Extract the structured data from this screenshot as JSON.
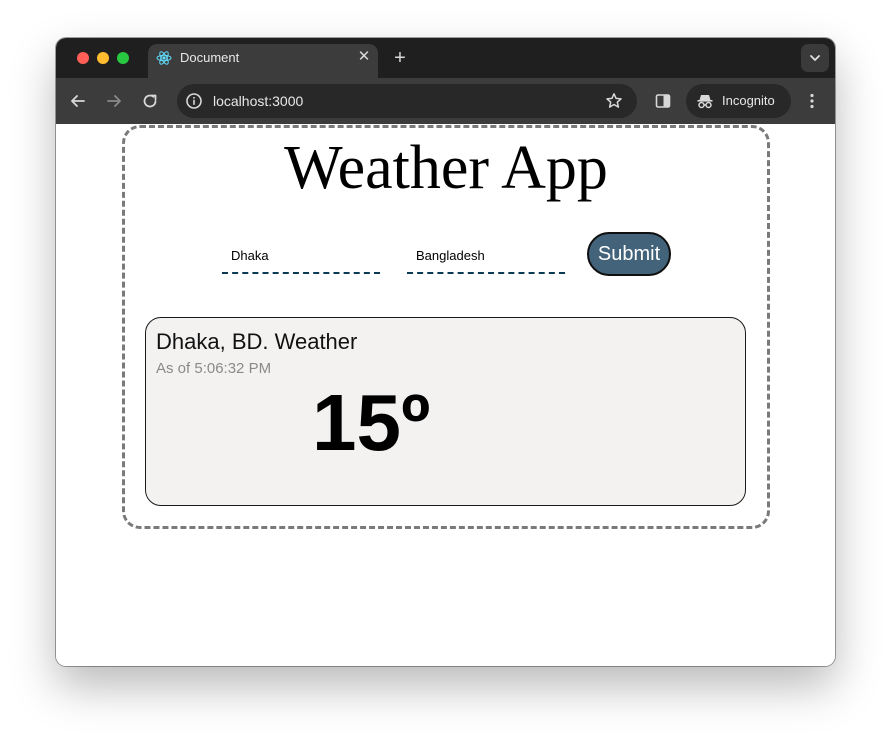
{
  "browser": {
    "tab_title": "Document",
    "url": "localhost:3000",
    "incognito_label": "Incognito",
    "icons": {
      "favicon": "react-icon",
      "tab_close": "close-icon",
      "new_tab": "plus-icon",
      "tab_menu": "chevron-down-icon",
      "back": "back-arrow-icon",
      "forward": "forward-arrow-icon",
      "reload": "reload-icon",
      "site_info": "info-icon",
      "bookmark": "star-icon",
      "side_panel": "side-panel-icon",
      "incognito": "incognito-icon",
      "menu": "more-vertical-icon"
    }
  },
  "app": {
    "title": "Weather App",
    "city_value": "Dhaka",
    "country_value": "Bangladesh",
    "submit_label": "Submit",
    "weather": {
      "heading": "Dhaka, BD. Weather",
      "as_of": "As of 5:06:32 PM",
      "temperature": "15º"
    }
  },
  "colors": {
    "submit_bg": "#42637a",
    "card_bg": "#f3f2f1",
    "field_underline": "#0b3a55",
    "app_border": "#7a7a7a"
  }
}
